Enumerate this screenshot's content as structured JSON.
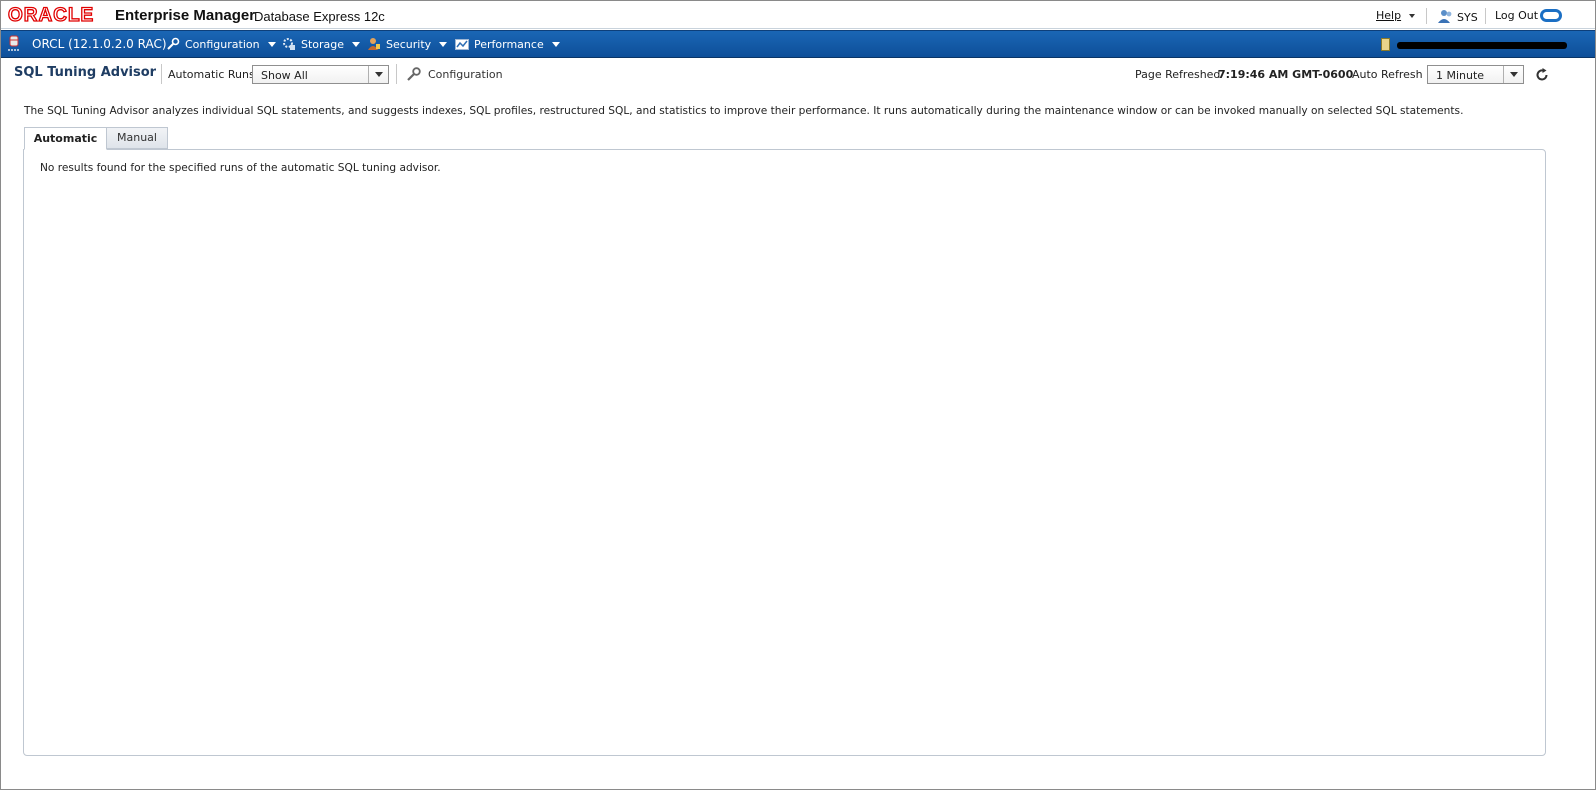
{
  "header": {
    "logo_text": "ORACLE",
    "title": "Enterprise Manager",
    "subtitle": "Database Express 12c",
    "help_label": "Help",
    "user_name": "SYS",
    "logout_label": "Log Out"
  },
  "nav": {
    "db_instance": "ORCL (12.1.0.2.0 RAC)",
    "items": [
      {
        "label": "Configuration",
        "icon": "wrench-icon"
      },
      {
        "label": "Storage",
        "icon": "storage-icon"
      },
      {
        "label": "Security",
        "icon": "security-icon"
      },
      {
        "label": "Performance",
        "icon": "performance-icon"
      }
    ]
  },
  "toolbar": {
    "page_title": "SQL Tuning Advisor",
    "automatic_runs_label": "Automatic Runs",
    "automatic_runs_value": "Show All",
    "configuration_label": "Configuration",
    "page_refreshed_label": "Page Refreshed",
    "page_refreshed_value": "7:19:46 AM GMT-0600",
    "auto_refresh_label": "Auto Refresh",
    "auto_refresh_value": "1 Minute"
  },
  "description": "The SQL Tuning Advisor analyzes individual SQL statements, and suggests indexes, SQL profiles, restructured SQL, and statistics to improve their performance. It runs automatically during the maintenance window or can be invoked manually on selected SQL statements.",
  "tabs": [
    {
      "label": "Automatic",
      "selected": true
    },
    {
      "label": "Manual",
      "selected": false
    }
  ],
  "content": {
    "no_results_message": "No results found for the specified runs of the automatic SQL tuning advisor."
  },
  "colors": {
    "brand_red": "#e00000",
    "nav_blue": "#1a66b5",
    "title_blue": "#1f3d63"
  }
}
